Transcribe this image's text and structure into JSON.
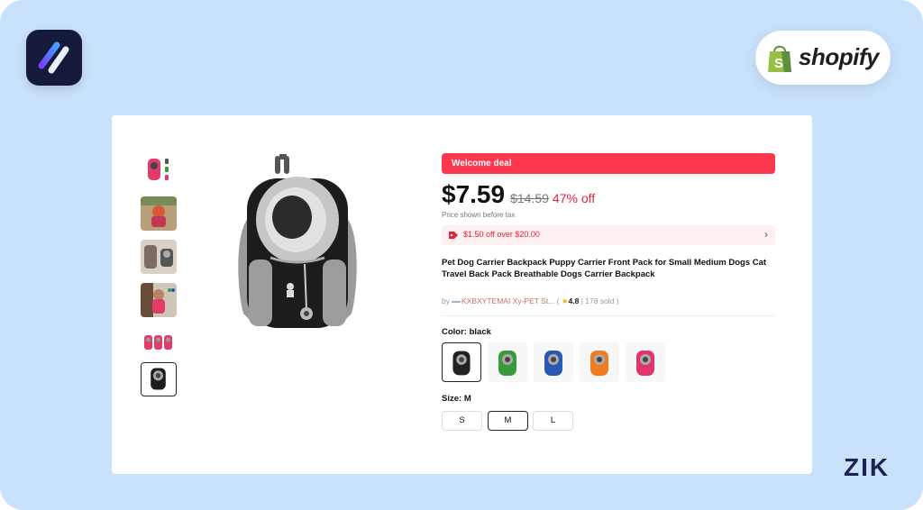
{
  "branding": {
    "left_logo": "app-logo-icon",
    "shopify_text": "shopify",
    "watermark": "ZIK"
  },
  "product": {
    "welcome_badge": "Welcome deal",
    "price": "$7.59",
    "original_price": "$14.59",
    "discount": "47% off",
    "tax_note": "Price shown before tax",
    "coupon": "$1.50 off over $20.00",
    "coupon_chevron": "›",
    "title": "Pet Dog Carrier Backpack Puppy Carrier Front Pack for Small Medium Dogs Cat Travel Back Pack Breathable Dogs Carrier Backpack",
    "seller": {
      "by": "by",
      "store": "KXBXYTEMAI Xy-PET St...",
      "rating_open": "(",
      "rating": "4.8",
      "sold": "| 178 sold )"
    },
    "color": {
      "label": "Color:",
      "value": "black",
      "options": [
        "black",
        "green",
        "blue",
        "orange",
        "pink"
      ],
      "option_colors": [
        "#222222",
        "#3a9a3a",
        "#2c58b5",
        "#f07c20",
        "#e0356b"
      ]
    },
    "size": {
      "label": "Size:",
      "value": "M",
      "options": [
        "S",
        "M",
        "L"
      ]
    },
    "thumbnail_count": 6,
    "selected_thumbnail": 6
  },
  "colors": {
    "accent_red": "#fd384f",
    "price_red": "#e0243c",
    "background": "#c9e2fb",
    "shopify_green": "#95bf47"
  }
}
